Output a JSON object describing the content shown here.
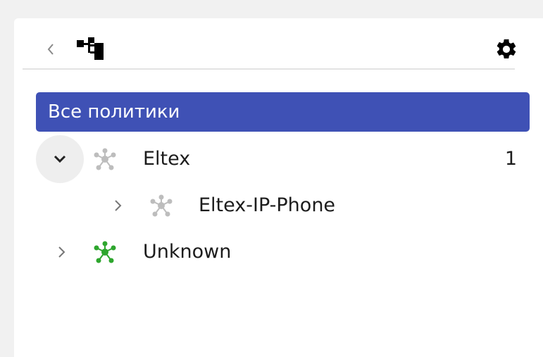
{
  "toolbar": {
    "back_icon": "chevron-left-icon",
    "tree_view_icon": "tree-structure-icon",
    "settings_icon": "gear-icon"
  },
  "all_policies_label": "Все политики",
  "tree": [
    {
      "label": "Eltex",
      "count": "1",
      "expanded": true,
      "icon": "network-node-icon",
      "icon_color": "#bdbdbd"
    },
    {
      "label": "Eltex-IP-Phone",
      "count": "",
      "expanded": false,
      "icon": "network-node-icon",
      "icon_color": "#bdbdbd"
    },
    {
      "label": "Unknown",
      "count": "",
      "expanded": false,
      "icon": "network-node-icon",
      "icon_color": "#2ea62e"
    }
  ],
  "colors": {
    "accent": "#3f51b5",
    "node_gray": "#bdbdbd",
    "node_green": "#2ea62e"
  }
}
